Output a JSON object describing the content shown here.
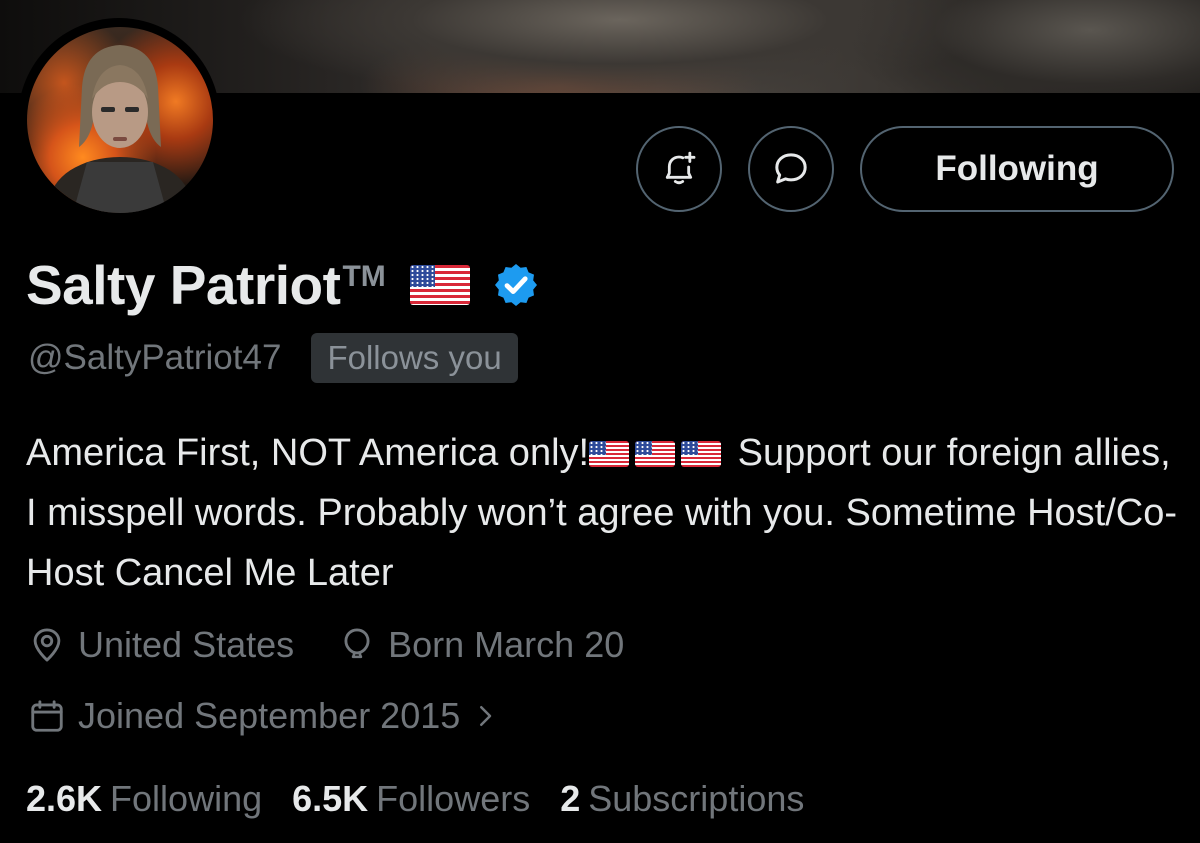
{
  "profile": {
    "display_name": "Salty Patriot",
    "trademark": "TM",
    "handle": "@SaltyPatriot47",
    "follows_you": "Follows you",
    "verified": true,
    "bio": {
      "part1": "America First, NOT America only!",
      "part2": "Support our foreign allies, I misspell words. Probably won’t agree with you. Sometime Host/Co-Host Cancel Me Later"
    },
    "location": "United States",
    "birthday": "Born March 20",
    "joined": "Joined September 2015"
  },
  "actions": {
    "notify_icon": "bell-plus-icon",
    "message_icon": "message-bubble-icon",
    "following_label": "Following"
  },
  "stats": {
    "following_count": "2.6K",
    "following_label": "Following",
    "followers_count": "6.5K",
    "followers_label": "Followers",
    "subscriptions_count": "2",
    "subscriptions_label": "Subscriptions"
  },
  "colors": {
    "background": "#000000",
    "primary_text": "#e7e9ea",
    "secondary_text": "#71767b",
    "verified_blue": "#1d9bf0",
    "button_border": "#536471"
  }
}
